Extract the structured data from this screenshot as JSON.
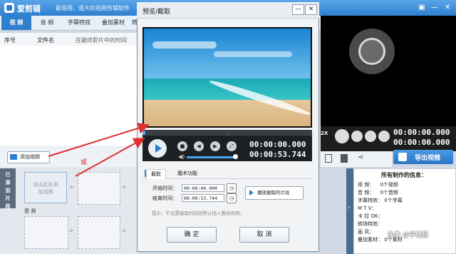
{
  "app": {
    "title": "爱剪辑",
    "subtitle": "最易用、强大的视频剪辑软件"
  },
  "window_controls": {
    "skin": "▣",
    "minimize": "—",
    "close": "✕"
  },
  "main_tabs": [
    "视 频",
    "音 频",
    "字幕特效",
    "叠加素材",
    "转"
  ],
  "list": {
    "columns": [
      "序号",
      "文件名",
      "在最终影片中的时间"
    ]
  },
  "add_video_label": "添加视频",
  "or_label": "或",
  "side_label": "已添加片段",
  "slot_hint": "双击此处添加视频",
  "audio_label": "音 频",
  "main_player": {
    "zoom": "2X",
    "time_current": "00:00:00.000",
    "time_total": "00:00:00.000"
  },
  "export_label": "导出视频",
  "info": {
    "title": "所有制作的信息：",
    "rows": [
      {
        "k": "视    频：",
        "v": "0个视频"
      },
      {
        "k": "音    频：",
        "v": "0个音频"
      },
      {
        "k": "字幕特效：",
        "v": "0个字幕"
      },
      {
        "k": "M  T  V：",
        "v": ""
      },
      {
        "k": "卡  拉  OK：",
        "v": ""
      },
      {
        "k": "转场特效：",
        "v": ""
      },
      {
        "k": "画    风：",
        "v": ""
      },
      {
        "k": "叠加素材：",
        "v": "0个素材"
      }
    ]
  },
  "watermark": "头条 @宁唔吕",
  "dialog": {
    "title": "预览/截取",
    "controls": {
      "minimize": "—",
      "close": "✕"
    },
    "time_current": "00:00:00.000",
    "time_total": "00:00:53.744",
    "tabs": [
      "截取",
      "魔术功能"
    ],
    "start_label": "开始时间：",
    "start_value": "00:00:00.000",
    "end_label": "结束时间：",
    "end_value": "00:00:53.744",
    "play_segment_label": "播放截取的片段",
    "tip": "提示：不设置截取时间则默认插入整段视频。",
    "ok_label": "确 定",
    "cancel_label": "取 消"
  }
}
